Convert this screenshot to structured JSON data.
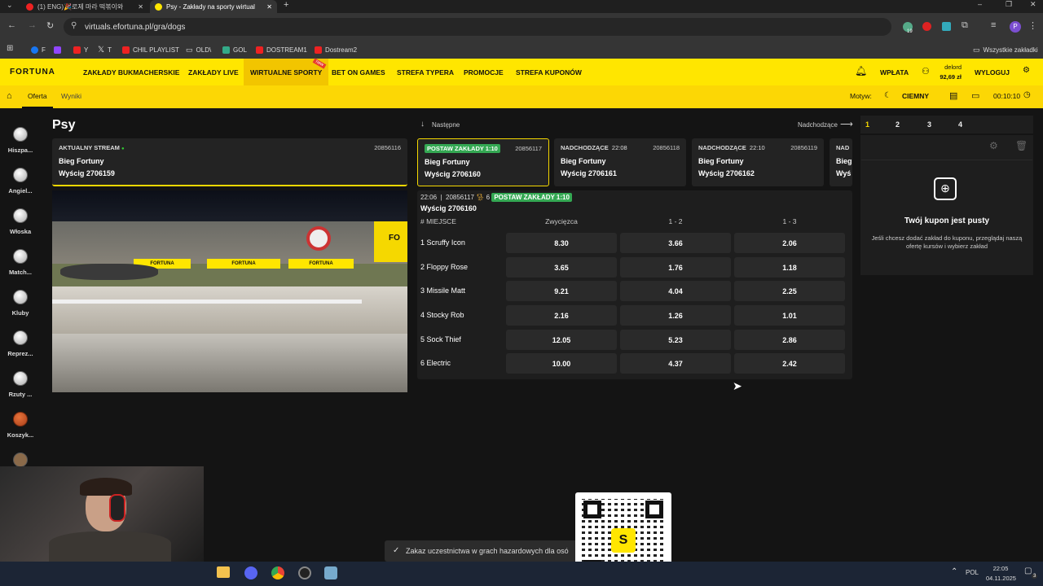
{
  "browser": {
    "tabs": [
      {
        "label": "(1) ENG)🎉로제 마라 떡볶이와"
      },
      {
        "label": "Psy - Zakłady na sporty wirtual"
      }
    ],
    "new_tab": "+",
    "url": "virtuals.efortuna.pl/gra/dogs",
    "bookmarks": [
      "F",
      "",
      "Y",
      "T",
      "CHIL PLAYLIST",
      "OLD\\",
      "GOL",
      "DOSTREAM1",
      "Dostream2"
    ],
    "all_bookmarks": "Wszystkie zakładki",
    "ext_badge": "19"
  },
  "site": {
    "logo": "FORTUNA",
    "nav": [
      "ZAKŁADY BUKMACHERSKIE",
      "ZAKŁADY LIVE",
      "WIRTUALNE SPORTY",
      "BET ON GAMES",
      "STREFA TYPERA",
      "PROMOCJE",
      "STREFA KUPONÓW"
    ],
    "new_badge": "new",
    "deposit": "WPŁATA",
    "user_name": "delord",
    "balance": "92,69 zł",
    "logout": "WYLOGUJ",
    "subnav": [
      "Oferta",
      "Wyniki"
    ],
    "theme_label": "Motyw:",
    "theme_value": "CIEMNY",
    "timer": "00:10:10"
  },
  "sports": [
    "Hiszpa...",
    "Angiel...",
    "Włoska",
    "Match...",
    "Kluby",
    "Reprez...",
    "Rzuty ...",
    "Koszyk..."
  ],
  "page": {
    "title": "Psy",
    "next_label": "Następne",
    "upcoming_label": "Nadchodzące"
  },
  "races": [
    {
      "status": "AKTUALNY STREAM",
      "id": "20856116",
      "line1": "Bieg Fortuny",
      "line2": "Wyścig 2706159"
    },
    {
      "status": "POSTAW ZAKŁADY 1:10",
      "id": "20856117",
      "line1": "Bieg Fortuny",
      "line2": "Wyścig 2706160"
    },
    {
      "status": "NADCHODZĄCE",
      "time": "22:08",
      "id": "20856118",
      "line1": "Bieg Fortuny",
      "line2": "Wyścig 2706161"
    },
    {
      "status": "NADCHODZĄCE",
      "time": "22:10",
      "id": "20856119",
      "line1": "Bieg Fortuny",
      "line2": "Wyścig 2706162"
    },
    {
      "status": "NAD",
      "line1": "Bieg",
      "line2": "Wyś"
    }
  ],
  "odds": {
    "time": "22:06",
    "id": "20856117",
    "runners_count": "6",
    "badge": "POSTAW ZAKŁADY 1:10",
    "race": "Wyścig 2706160",
    "headers": [
      "# MIEJSCE",
      "Zwycięzca",
      "1 - 2",
      "1 - 3"
    ],
    "rows": [
      {
        "name": "1 Scruffy Icon",
        "w": "8.30",
        "p2": "3.66",
        "p3": "2.06"
      },
      {
        "name": "2 Floppy Rose",
        "w": "3.65",
        "p2": "1.76",
        "p3": "1.18"
      },
      {
        "name": "3 Missile Matt",
        "w": "9.21",
        "p2": "4.04",
        "p3": "2.25"
      },
      {
        "name": "4 Stocky Rob",
        "w": "2.16",
        "p2": "1.26",
        "p3": "1.01"
      },
      {
        "name": "5 Sock Thief",
        "w": "12.05",
        "p2": "5.23",
        "p3": "2.86"
      },
      {
        "name": "6 Electric",
        "w": "10.00",
        "p2": "4.37",
        "p3": "2.42"
      }
    ]
  },
  "coupon": {
    "tabs": [
      "1",
      "2",
      "3",
      "4"
    ],
    "title": "Twój kupon jest pusty",
    "desc": "Jeśli chcesz dodać zakład do kuponu, przeglądaj naszą ofertę kursów i wybierz zakład"
  },
  "footer": {
    "notice": "Zakaz uczestnictwa w grach hazardowych dla osó",
    "qr_letter": "S"
  },
  "video": {
    "banners": [
      "FORTUNA",
      "FORTUNA",
      "FORTUNA"
    ],
    "side_banner": "FO"
  },
  "taskbar": {
    "lang": "POL",
    "time": "22:05",
    "date": "04.11.2025",
    "notif": "3"
  }
}
